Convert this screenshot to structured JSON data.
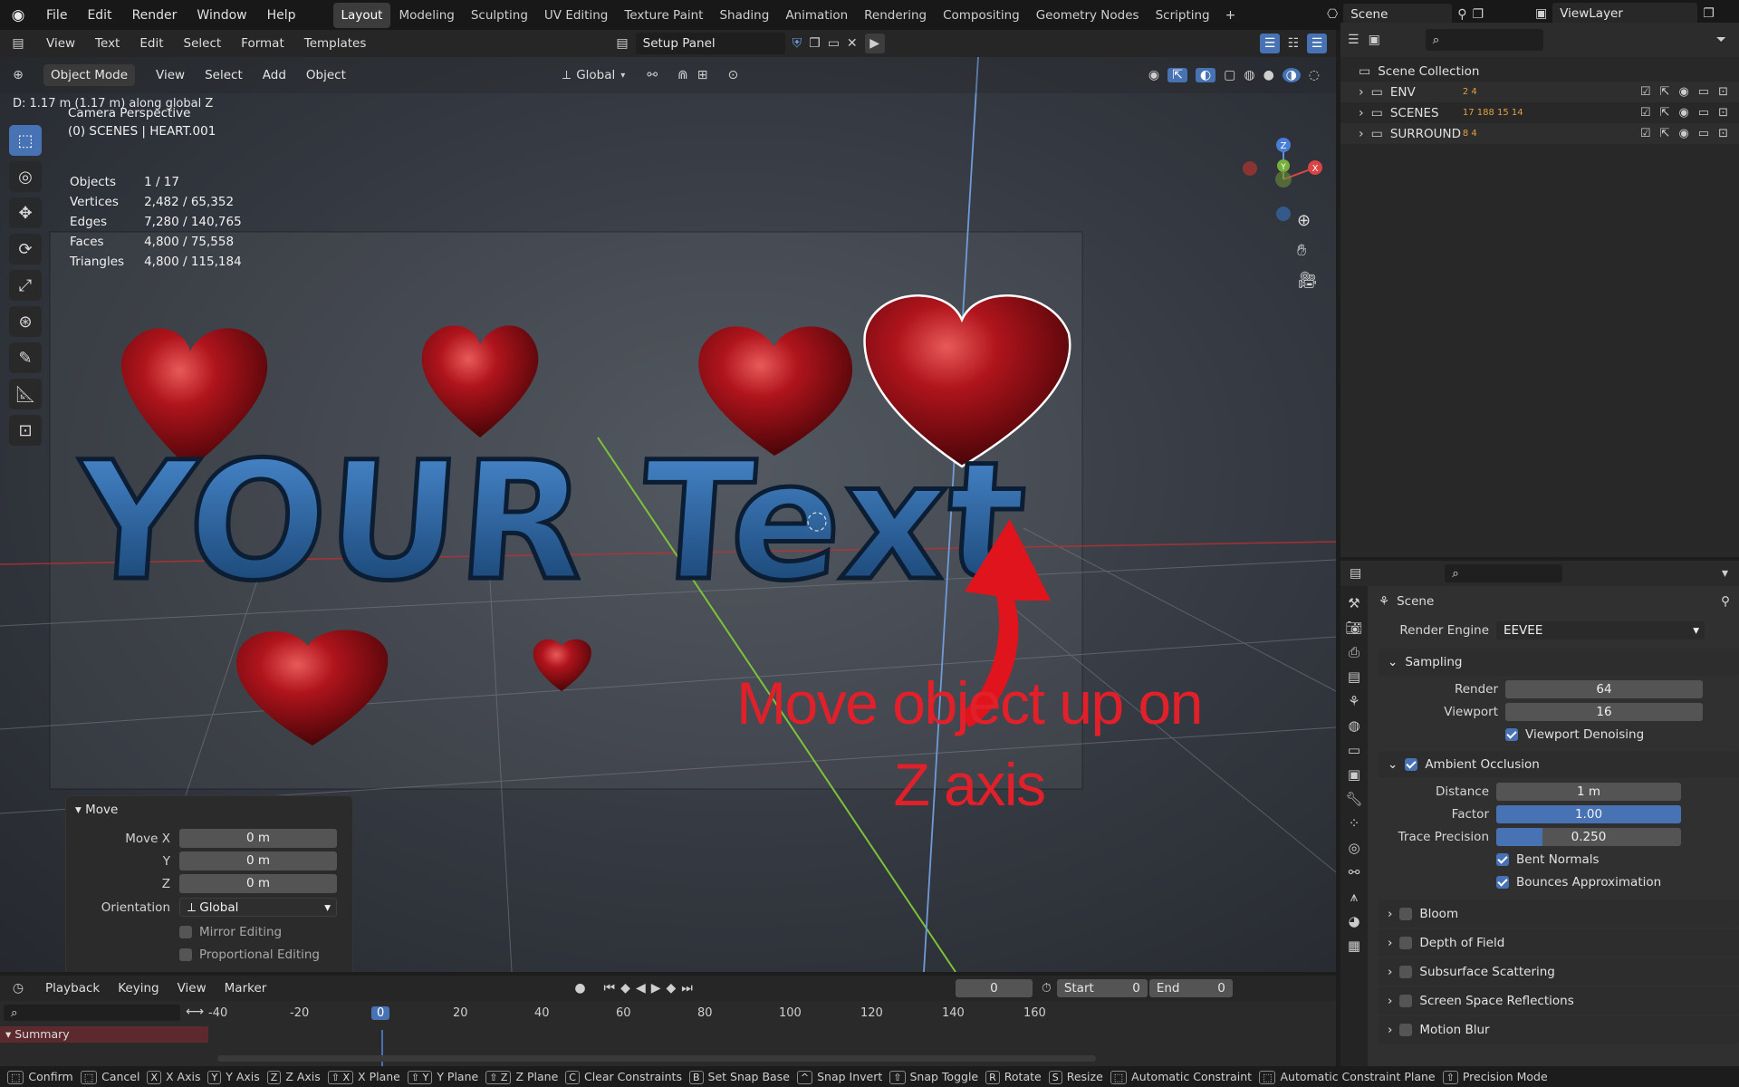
{
  "topbar": {
    "menu": [
      "File",
      "Edit",
      "Render",
      "Window",
      "Help"
    ],
    "workspaces": [
      "Layout",
      "Modeling",
      "Sculpting",
      "UV Editing",
      "Texture Paint",
      "Shading",
      "Animation",
      "Rendering",
      "Compositing",
      "Geometry Nodes",
      "Scripting"
    ],
    "active_workspace": "Layout",
    "scene": "Scene",
    "view_layer": "ViewLayer"
  },
  "text_editor": {
    "menu": [
      "View",
      "Text",
      "Edit",
      "Select",
      "Format",
      "Templates"
    ],
    "file": "Setup Panel"
  },
  "viewport": {
    "mode": "Object Mode",
    "menu": [
      "View",
      "Select",
      "Add",
      "Object"
    ],
    "orientation": "Global",
    "status": "D: 1.17 m (1.17 m) along global Z",
    "camera": "Camera Perspective",
    "object_path": "(0) SCENES | HEART.001",
    "stats": [
      {
        "label": "Objects",
        "value": "1 / 17"
      },
      {
        "label": "Vertices",
        "value": "2,482 / 65,352"
      },
      {
        "label": "Edges",
        "value": "7,280 / 140,765"
      },
      {
        "label": "Faces",
        "value": "4,800 / 75,558"
      },
      {
        "label": "Triangles",
        "value": "4,800 / 115,184"
      }
    ],
    "scene_text": "YOUR Text",
    "overlay_line1": "Move object up on",
    "overlay_line2": "Z axis",
    "gizmo_labels": {
      "z": "Z",
      "y": "Y",
      "x": "X"
    }
  },
  "move_panel": {
    "title": "Move",
    "move_x_label": "Move X",
    "move_x": "0 m",
    "y_label": "Y",
    "y": "0 m",
    "z_label": "Z",
    "z": "0 m",
    "orientation_label": "Orientation",
    "orientation": "Global",
    "mirror": "Mirror Editing",
    "proportional": "Proportional Editing"
  },
  "outliner": {
    "root": "Scene Collection",
    "items": [
      {
        "name": "ENV",
        "badges": "2  4"
      },
      {
        "name": "SCENES",
        "badges": "17 188  15 14"
      },
      {
        "name": "SURROUND",
        "badges": "8  4"
      }
    ]
  },
  "properties": {
    "context": "Scene",
    "render_engine_label": "Render Engine",
    "render_engine": "EEVEE",
    "sampling": "Sampling",
    "render_label": "Render",
    "render": "64",
    "viewport_label": "Viewport",
    "viewport": "16",
    "denoise": "Viewport Denoising",
    "ao": "Ambient Occlusion",
    "distance_label": "Distance",
    "distance": "1 m",
    "factor_label": "Factor",
    "factor": "1.00",
    "factor_fill": 1.0,
    "trace_label": "Trace Precision",
    "trace": "0.250",
    "trace_fill": 0.25,
    "bent_normals": "Bent Normals",
    "bounces": "Bounces Approximation",
    "sections": [
      "Bloom",
      "Depth of Field",
      "Subsurface Scattering",
      "Screen Space Reflections",
      "Motion Blur"
    ]
  },
  "timeline": {
    "menu": [
      "Playback",
      "Keying",
      "View",
      "Marker"
    ],
    "frame": "0",
    "start_label": "Start",
    "start": "0",
    "end_label": "End",
    "end": "0",
    "ticks": [
      "-40",
      "-20",
      "0",
      "20",
      "40",
      "60",
      "80",
      "100",
      "120",
      "140",
      "160"
    ],
    "summary": "Summary"
  },
  "statusbar": [
    {
      "key": "",
      "label": "Confirm"
    },
    {
      "key": "",
      "label": "Cancel"
    },
    {
      "key": "X",
      "label": "X Axis"
    },
    {
      "key": "Y",
      "label": "Y Axis"
    },
    {
      "key": "Z",
      "label": "Z Axis"
    },
    {
      "key": "⇧ X",
      "label": "X Plane"
    },
    {
      "key": "⇧ Y",
      "label": "Y Plane"
    },
    {
      "key": "⇧ Z",
      "label": "Z Plane"
    },
    {
      "key": "C",
      "label": "Clear Constraints"
    },
    {
      "key": "B",
      "label": "Set Snap Base"
    },
    {
      "key": "^",
      "label": "Snap Invert"
    },
    {
      "key": "⇧",
      "label": "Snap Toggle"
    },
    {
      "key": "R",
      "label": "Rotate"
    },
    {
      "key": "S",
      "label": "Resize"
    },
    {
      "key": "",
      "label": "Automatic Constraint"
    },
    {
      "key": "",
      "label": "Automatic Constraint Plane"
    },
    {
      "key": "⇧",
      "label": "Precision Mode"
    }
  ],
  "colors": {
    "accent": "#4772b3",
    "overlay_red": "#e2202a",
    "text_blue": "#2f6fb5",
    "heart_red": "#a5141c"
  }
}
